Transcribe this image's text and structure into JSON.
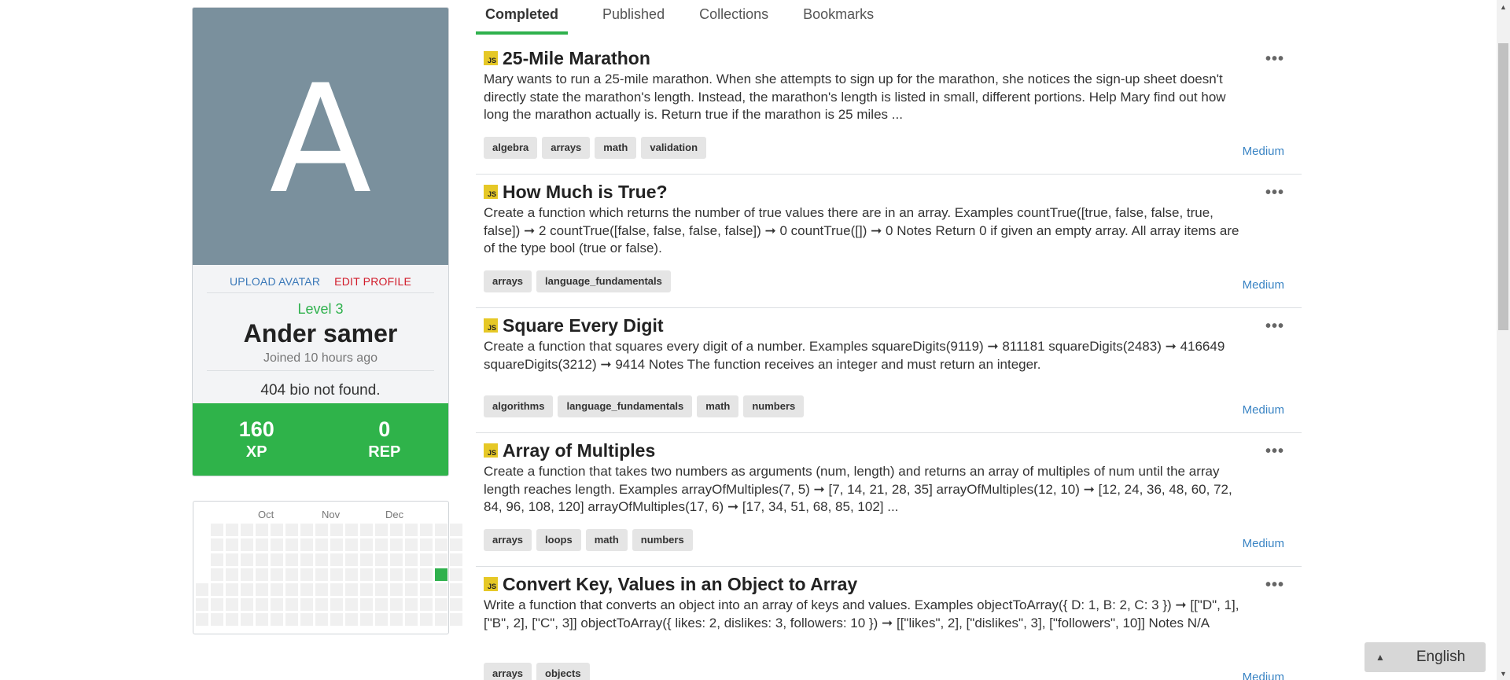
{
  "profile": {
    "avatar_letter": "A",
    "upload_avatar": "UPLOAD AVATAR",
    "edit_profile": "EDIT PROFILE",
    "level": "Level 3",
    "username": "Ander samer",
    "joined": "Joined 10 hours ago",
    "bio": "404 bio not found.",
    "xp_value": "160",
    "xp_label": "XP",
    "rep_value": "0",
    "rep_label": "REP"
  },
  "calendar": {
    "months": [
      "Oct",
      "Nov",
      "Dec"
    ],
    "active_days": 1
  },
  "tabs": [
    "Completed",
    "Published",
    "Collections",
    "Bookmarks"
  ],
  "active_tab": "Completed",
  "challenges": [
    {
      "badge": "JS",
      "title": "25-Mile Marathon",
      "description": "Mary wants to run a 25-mile marathon. When she attempts to sign up for the marathon, she notices the sign-up sheet doesn't directly state the marathon's length. Instead, the marathon's length is listed in small, different portions. Help Mary find out how long the marathon actually is. Return true if the marathon is 25 miles ...",
      "tags": [
        "algebra",
        "arrays",
        "math",
        "validation"
      ],
      "difficulty": "Medium"
    },
    {
      "badge": "JS",
      "title": "How Much is True?",
      "description": "Create a function which returns the number of true values there are in an array. Examples countTrue([true, false, false, true, false]) ➞ 2 countTrue([false, false, false, false]) ➞ 0 countTrue([]) ➞ 0 Notes Return 0 if given an empty array. All array items are of the type bool (true or false).",
      "tags": [
        "arrays",
        "language_fundamentals"
      ],
      "difficulty": "Medium"
    },
    {
      "badge": "JS",
      "title": "Square Every Digit",
      "description": "Create a function that squares every digit of a number. Examples squareDigits(9119) ➞ 811181 squareDigits(2483) ➞ 416649 squareDigits(3212) ➞ 9414 Notes The function receives an integer and must return an integer.",
      "tags": [
        "algorithms",
        "language_fundamentals",
        "math",
        "numbers"
      ],
      "difficulty": "Medium"
    },
    {
      "badge": "JS",
      "title": "Array of Multiples",
      "description": "Create a function that takes two numbers as arguments (num, length) and returns an array of multiples of num until the array length reaches length. Examples arrayOfMultiples(7, 5) ➞ [7, 14, 21, 28, 35] arrayOfMultiples(12, 10) ➞ [12, 24, 36, 48, 60, 72, 84, 96, 108, 120] arrayOfMultiples(17, 6) ➞ [17, 34, 51, 68, 85, 102] ...",
      "tags": [
        "arrays",
        "loops",
        "math",
        "numbers"
      ],
      "difficulty": "Medium"
    },
    {
      "badge": "JS",
      "title": "Convert Key, Values in an Object to Array",
      "description": "Write a function that converts an object into an array of keys and values. Examples objectToArray({ D: 1, B: 2, C: 3 }) ➞ [[\"D\", 1], [\"B\", 2], [\"C\", 3]] objectToArray({ likes: 2, dislikes: 3, followers: 10 }) ➞ [[\"likes\", 2], [\"dislikes\", 3], [\"followers\", 10]] Notes N/A",
      "tags": [
        "arrays",
        "objects"
      ],
      "difficulty": "Medium"
    }
  ],
  "more_icon": "•••",
  "language": {
    "label": "English",
    "icon": "caret-up-icon"
  }
}
